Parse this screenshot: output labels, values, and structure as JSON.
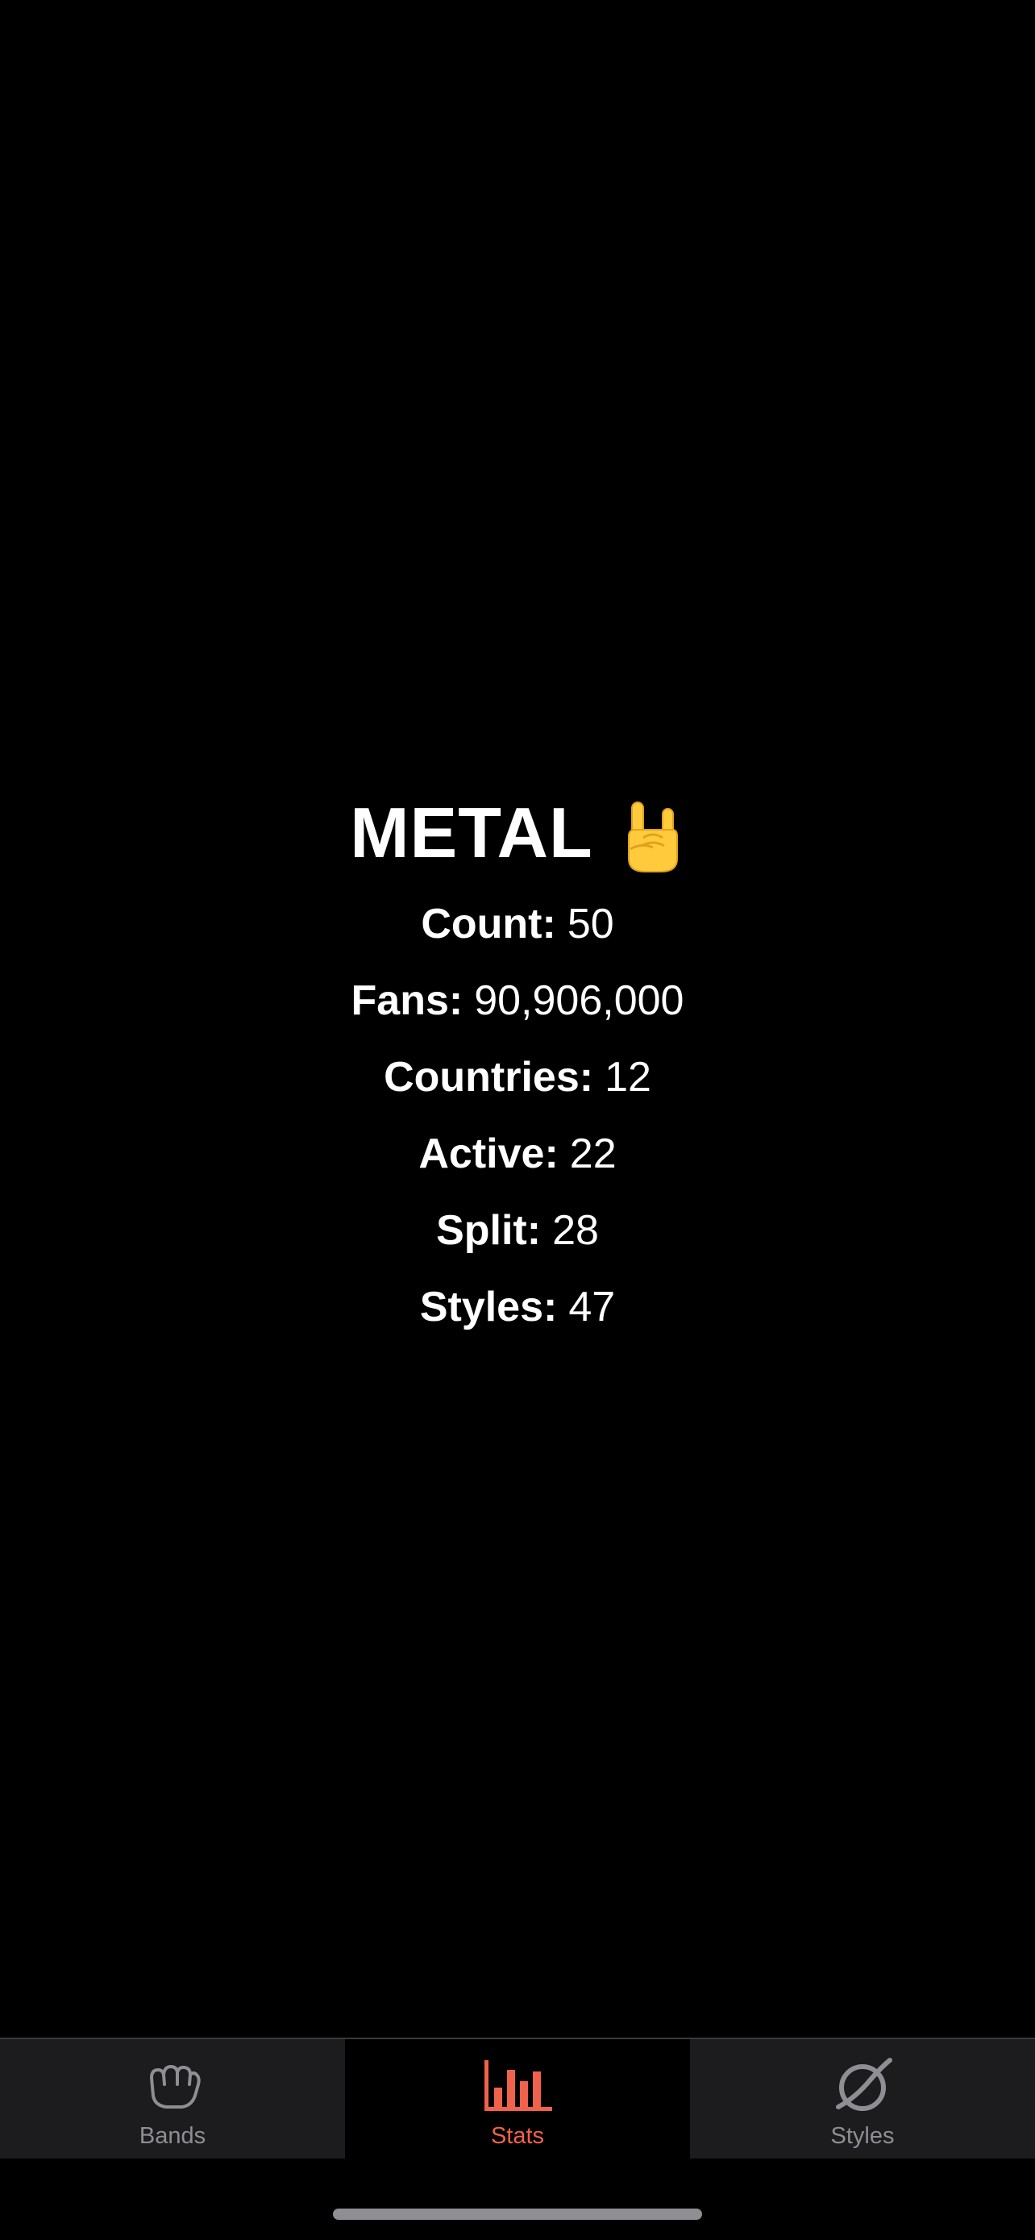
{
  "header": {
    "title": "METAL",
    "emoji": "🤘"
  },
  "stats": [
    {
      "label": "Count:",
      "value": "50"
    },
    {
      "label": "Fans:",
      "value": "90,906,000"
    },
    {
      "label": "Countries:",
      "value": "12"
    },
    {
      "label": "Active:",
      "value": "22"
    },
    {
      "label": "Split:",
      "value": "28"
    },
    {
      "label": "Styles:",
      "value": "47"
    }
  ],
  "tabbar": {
    "selected": "Stats",
    "accent_color": "#f0624b",
    "inactive_color": "#8e8e93",
    "tabs": [
      {
        "label": "Bands",
        "icon": "fist-icon"
      },
      {
        "label": "Stats",
        "icon": "bar-chart-icon"
      },
      {
        "label": "Styles",
        "icon": "planet-ring-icon"
      }
    ]
  }
}
